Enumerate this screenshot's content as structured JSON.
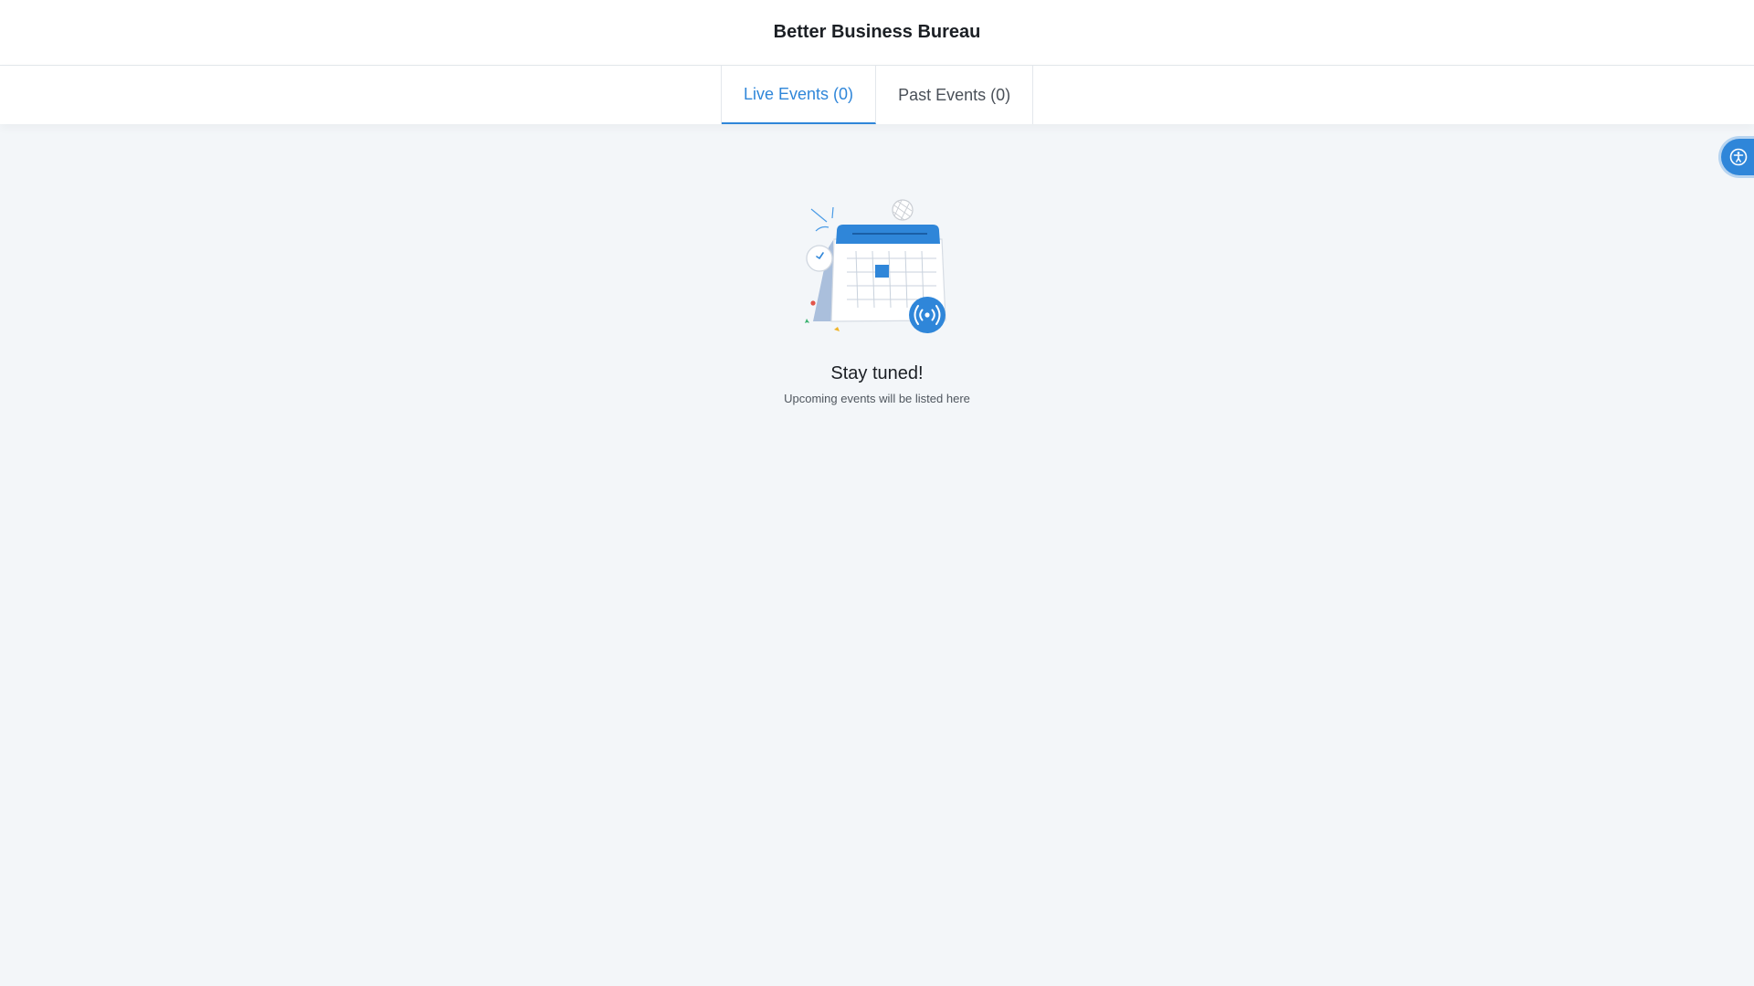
{
  "header": {
    "title": "Better Business Bureau"
  },
  "tabs": [
    {
      "label": "Live Events (0)",
      "active": true
    },
    {
      "label": "Past Events (0)",
      "active": false
    }
  ],
  "empty_state": {
    "title": "Stay tuned!",
    "subtitle": "Upcoming events will be listed here",
    "icon": "calendar-broadcast-illustration"
  },
  "accessibility_widget": {
    "icon": "accessibility-icon"
  },
  "colors": {
    "accent": "#2f86d9",
    "background": "#f3f6f9",
    "surface": "#ffffff"
  }
}
